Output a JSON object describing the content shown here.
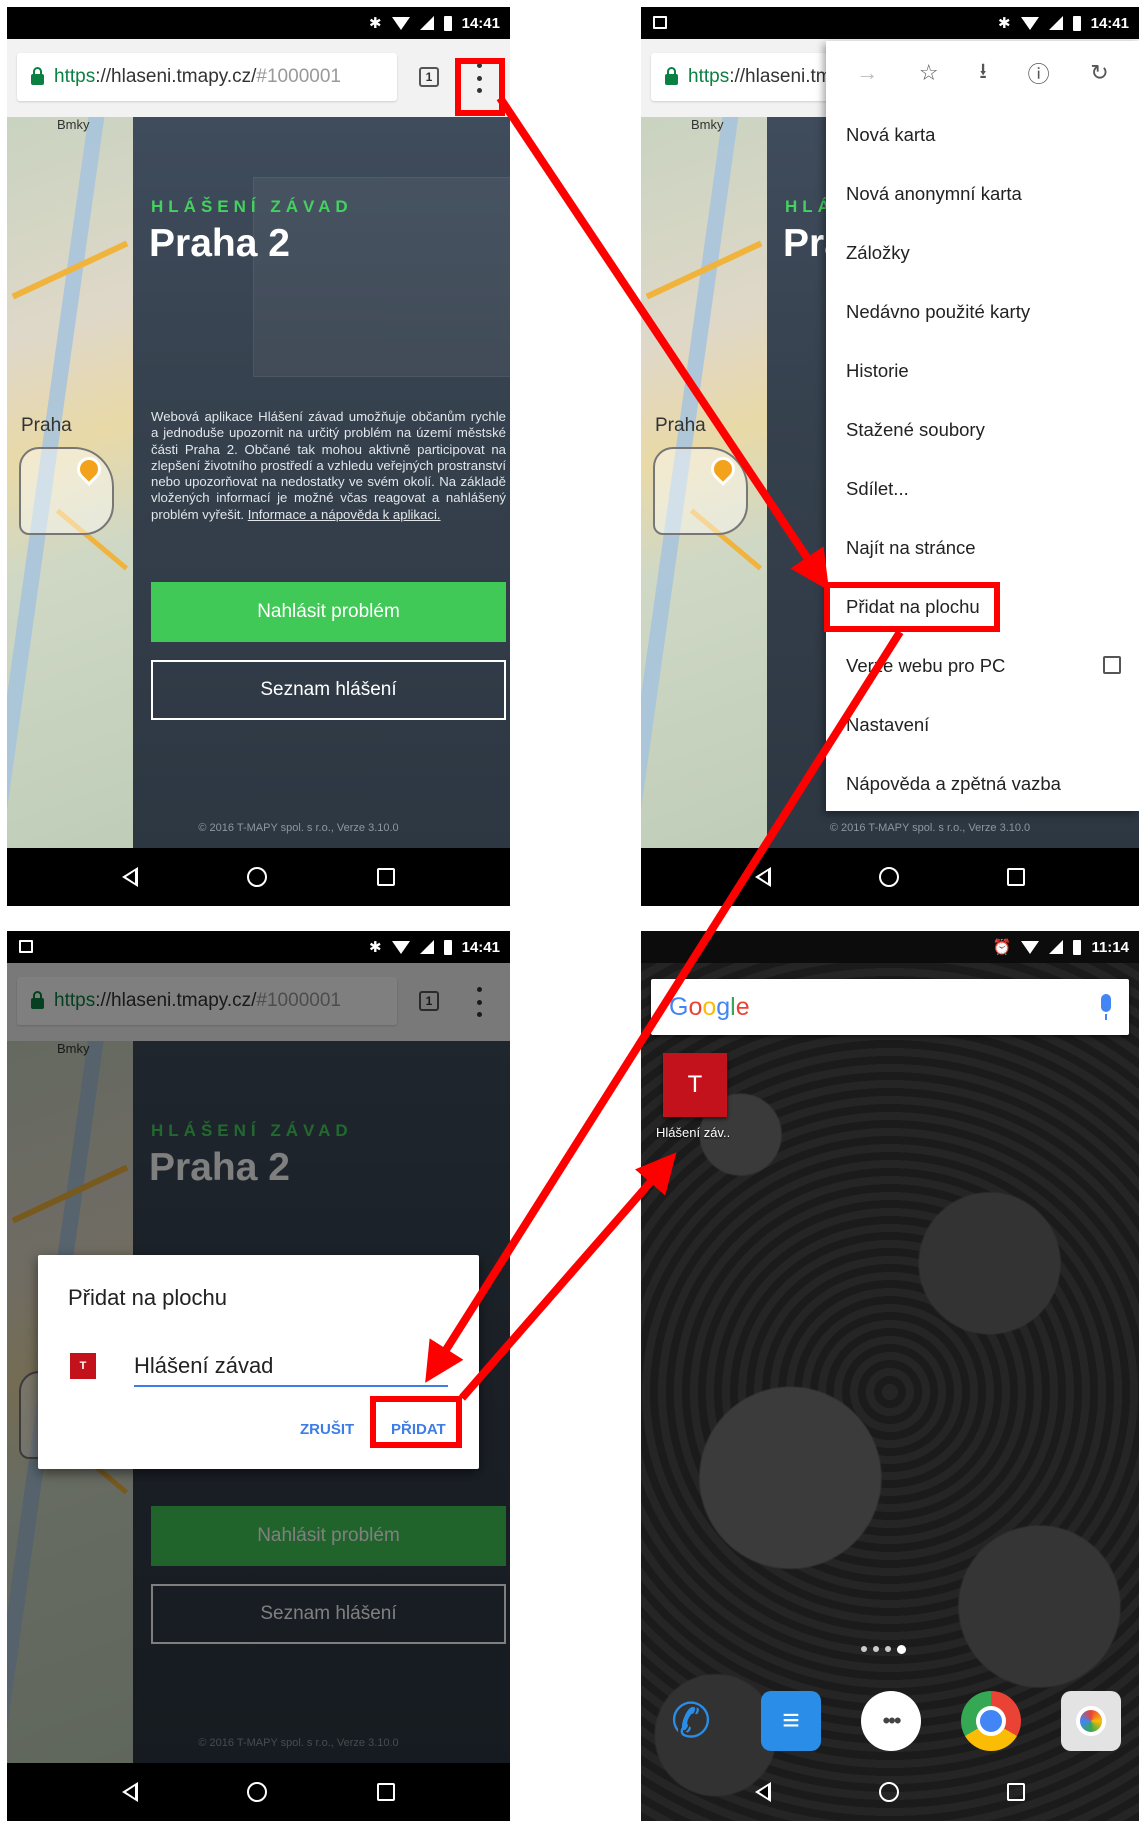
{
  "status": {
    "time_browser": "14:41",
    "time_home": "11:14"
  },
  "browser": {
    "url_scheme": "https",
    "url_host": "://hlaseni.tmapy.cz/",
    "url_hash": "#1000001",
    "url_truncated": "https://hlaseni.",
    "tab_count": "1"
  },
  "page": {
    "kicker": "HLÁŠENÍ ZÁVAD",
    "city": "Praha 2",
    "description": "Webová aplikace Hlášení závad umožňuje občanům rychle a jednoduše upozornit na určitý problém na území městské části Praha 2. Občané tak mohou aktivně participovat na zlepšení životního prostředí a vzhledu veřejných prostranství nebo upozorňovat na nedostatky ve svém okolí. Na základě vložených informací je možné včas reagovat a nahlášený problém vyřešit.",
    "help_link": "Informace a nápověda k aplikaci.",
    "report_button": "Nahlásit problém",
    "list_button": "Seznam hlášení",
    "footer": "© 2016 T-MAPY spol. s r.o., Verze 3.10.0",
    "map_label_city": "Praha",
    "map_label_top": "Bmky"
  },
  "menu": {
    "items": [
      "Nová karta",
      "Nová anonymní karta",
      "Záložky",
      "Nedávno použité karty",
      "Historie",
      "Stažené soubory",
      "Sdílet...",
      "Najít na stránce",
      "Přidat na plochu",
      "Verze webu pro PC",
      "Nastavení",
      "Nápověda a zpětná vazba"
    ]
  },
  "dialog": {
    "title": "Přidat na plochu",
    "icon_letter": "T",
    "input_value": "Hlášení závad",
    "cancel": "ZRUŠIT",
    "add": "PŘIDAT"
  },
  "home": {
    "google": [
      "G",
      "o",
      "o",
      "g",
      "l",
      "e"
    ],
    "shortcut_letter": "T",
    "shortcut_label": "Hlášení záv..",
    "apps_glyph": "•••"
  },
  "colors": {
    "highlight": "#ff0000",
    "green_button": "#41c957",
    "accent_blue": "#3d7de6",
    "shortcut_red": "#c4121d"
  }
}
